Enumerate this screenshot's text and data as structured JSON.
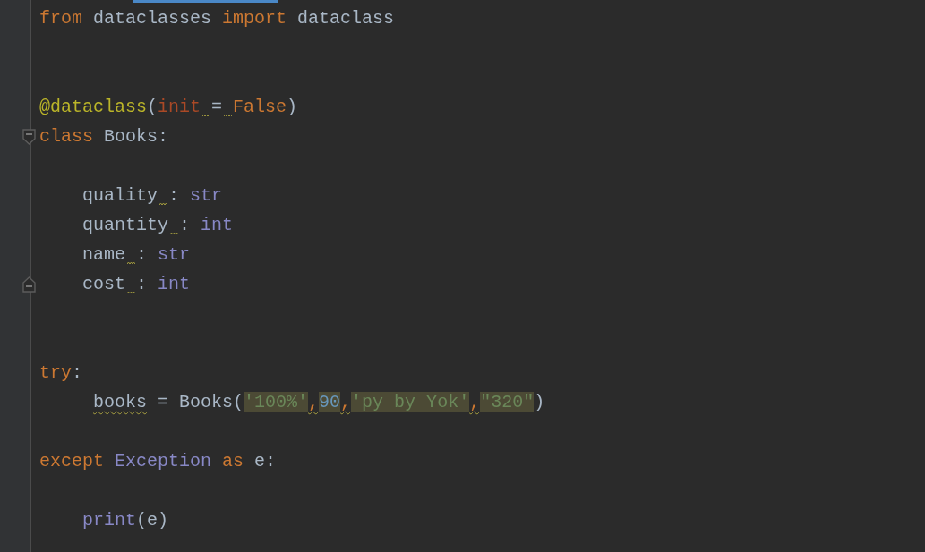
{
  "editor": {
    "lines": [
      {
        "kind": "code",
        "tokens": [
          {
            "text": "from",
            "kind": "keyword"
          },
          {
            "text": " dataclasses ",
            "kind": "plain"
          },
          {
            "text": "import",
            "kind": "keyword"
          },
          {
            "text": " dataclass",
            "kind": "plain"
          }
        ]
      },
      {
        "kind": "blank"
      },
      {
        "kind": "blank"
      },
      {
        "kind": "code",
        "tokens": [
          {
            "text": "@dataclass",
            "kind": "decorator"
          },
          {
            "text": "(",
            "kind": "plain"
          },
          {
            "text": "init",
            "kind": "param",
            "warn_after": true
          },
          {
            "text": "=",
            "kind": "plain",
            "warn_after": true
          },
          {
            "text": "False",
            "kind": "keyword"
          },
          {
            "text": ")",
            "kind": "plain"
          }
        ]
      },
      {
        "kind": "code",
        "expanded": true,
        "tokens": [
          {
            "text": "class",
            "kind": "keyword"
          },
          {
            "text": " Books:",
            "kind": "plain"
          }
        ],
        "children": [
          {
            "kind": "blank"
          },
          {
            "kind": "code",
            "tokens": [
              {
                "text": "quality",
                "kind": "plain",
                "warn_after": true
              },
              {
                "text": ": ",
                "kind": "plain"
              },
              {
                "text": "str",
                "kind": "type"
              }
            ]
          },
          {
            "kind": "code",
            "tokens": [
              {
                "text": "quantity",
                "kind": "plain",
                "warn_after": true
              },
              {
                "text": ": ",
                "kind": "plain"
              },
              {
                "text": "int",
                "kind": "type"
              }
            ]
          },
          {
            "kind": "code",
            "tokens": [
              {
                "text": "name",
                "kind": "plain",
                "warn_after": true
              },
              {
                "text": ": ",
                "kind": "plain"
              },
              {
                "text": "str",
                "kind": "type"
              }
            ]
          },
          {
            "kind": "code",
            "tokens": [
              {
                "text": "cost",
                "kind": "plain",
                "warn_after": true
              },
              {
                "text": ": ",
                "kind": "plain"
              },
              {
                "text": "int",
                "kind": "type"
              }
            ]
          }
        ]
      },
      {
        "kind": "blank"
      },
      {
        "kind": "blank"
      },
      {
        "kind": "code",
        "tokens": [
          {
            "text": "try",
            "kind": "keyword"
          },
          {
            "text": ":",
            "kind": "plain"
          }
        ],
        "children": [
          {
            "kind": "code",
            "misaligned": true,
            "tokens": [
              {
                "text": "books",
                "kind": "plain",
                "warning": true
              },
              {
                "text": " = Books(",
                "kind": "plain"
              },
              {
                "text": "'100%'",
                "kind": "string",
                "highlight": true
              },
              {
                "text": ",",
                "kind": "keyword",
                "warning": true
              },
              {
                "text": "90",
                "kind": "number",
                "highlight": true
              },
              {
                "text": ",",
                "kind": "keyword",
                "warning": true
              },
              {
                "text": "'py by Yok'",
                "kind": "string",
                "highlight": true
              },
              {
                "text": ",",
                "kind": "keyword",
                "warning": true
              },
              {
                "text": "\"320\"",
                "kind": "string",
                "highlight": true
              },
              {
                "text": ")",
                "kind": "plain"
              }
            ]
          }
        ]
      },
      {
        "kind": "blank"
      },
      {
        "kind": "code",
        "tokens": [
          {
            "text": "except ",
            "kind": "keyword"
          },
          {
            "text": "Exception ",
            "kind": "type"
          },
          {
            "text": "as",
            "kind": "keyword"
          },
          {
            "text": " e:",
            "kind": "plain"
          }
        ],
        "children": [
          {
            "kind": "blank"
          },
          {
            "kind": "code",
            "tokens": [
              {
                "text": "print",
                "kind": "type"
              },
              {
                "text": "(e)",
                "kind": "plain"
              }
            ]
          }
        ]
      }
    ]
  }
}
